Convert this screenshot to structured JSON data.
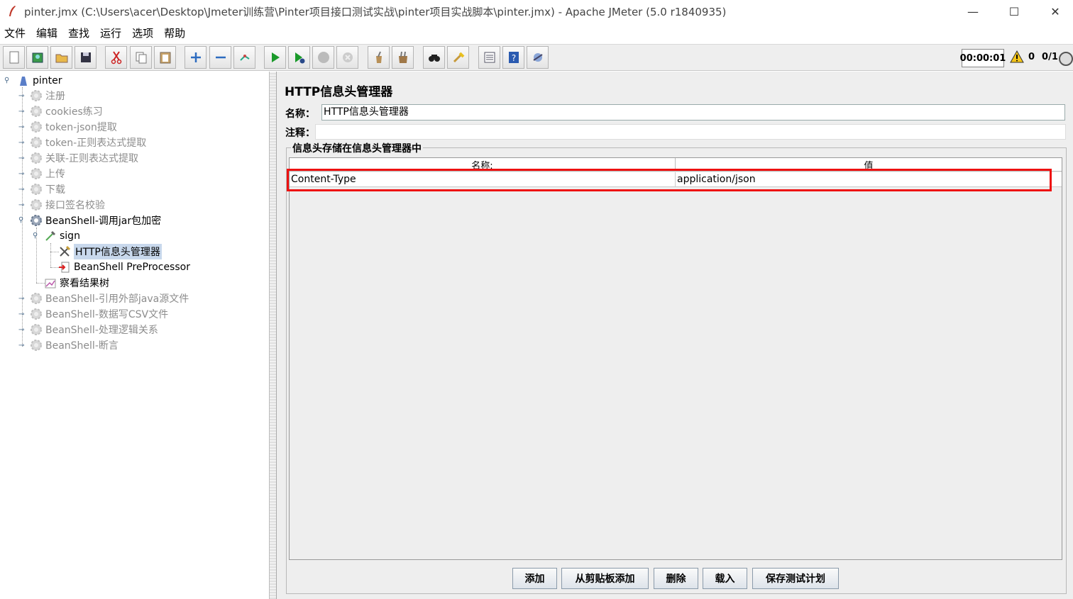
{
  "window": {
    "title": "pinter.jmx (C:\\Users\\acer\\Desktop\\Jmeter训练营\\Pinter项目接口测试实战\\pinter项目实战脚本\\pinter.jmx) - Apache JMeter (5.0 r1840935)",
    "minimize": "—",
    "maximize": "☐",
    "close": "✕"
  },
  "menu": [
    "文件",
    "编辑",
    "查找",
    "运行",
    "选项",
    "帮助"
  ],
  "toolbar": {
    "icons": [
      "new-icon",
      "templates-icon",
      "open-icon",
      "save-icon",
      "cut-icon",
      "copy-icon",
      "paste-icon",
      "expand-icon",
      "collapse-icon",
      "toggle-icon",
      "start-icon",
      "start-no-pause-icon",
      "stop-icon",
      "shutdown-icon",
      "clear-icon",
      "clear-all-icon",
      "search-icon",
      "reset-search-icon",
      "function-helper-icon",
      "help-icon",
      "remote-icon"
    ],
    "timer": "00:00:01",
    "warning_count": "0",
    "threads": "0/1"
  },
  "tree": {
    "root": "pinter",
    "items": [
      {
        "label": "注册",
        "disabled": true
      },
      {
        "label": "cookies练习",
        "disabled": true
      },
      {
        "label": "token-json提取",
        "disabled": true
      },
      {
        "label": "token-正则表达式提取",
        "disabled": true
      },
      {
        "label": "关联-正则表达式提取",
        "disabled": true
      },
      {
        "label": "上传",
        "disabled": true
      },
      {
        "label": "下载",
        "disabled": true
      },
      {
        "label": "接口签名校验",
        "disabled": true
      },
      {
        "label": "BeanShell-调用jar包加密",
        "disabled": false
      },
      {
        "label": "sign",
        "disabled": false
      },
      {
        "label": "HTTP信息头管理器",
        "disabled": false,
        "selected": true
      },
      {
        "label": "BeanShell PreProcessor",
        "disabled": false
      },
      {
        "label": "察看结果树",
        "disabled": false
      },
      {
        "label": "BeanShell-引用外部java源文件",
        "disabled": true
      },
      {
        "label": "BeanShell-数据写CSV文件",
        "disabled": true
      },
      {
        "label": "BeanShell-处理逻辑关系",
        "disabled": true
      },
      {
        "label": "BeanShell-断言",
        "disabled": true
      }
    ]
  },
  "panel": {
    "title": "HTTP信息头管理器",
    "name_label": "名称：",
    "name_value": "HTTP信息头管理器",
    "comment_label": "注释：",
    "group_title": "信息头存储在信息头管理器中",
    "columns": [
      "名称:",
      "值"
    ],
    "rows": [
      {
        "name": "Content-Type",
        "value": "application/json"
      }
    ],
    "buttons": [
      "添加",
      "从剪贴板添加",
      "删除",
      "载入",
      "保存测试计划"
    ]
  }
}
